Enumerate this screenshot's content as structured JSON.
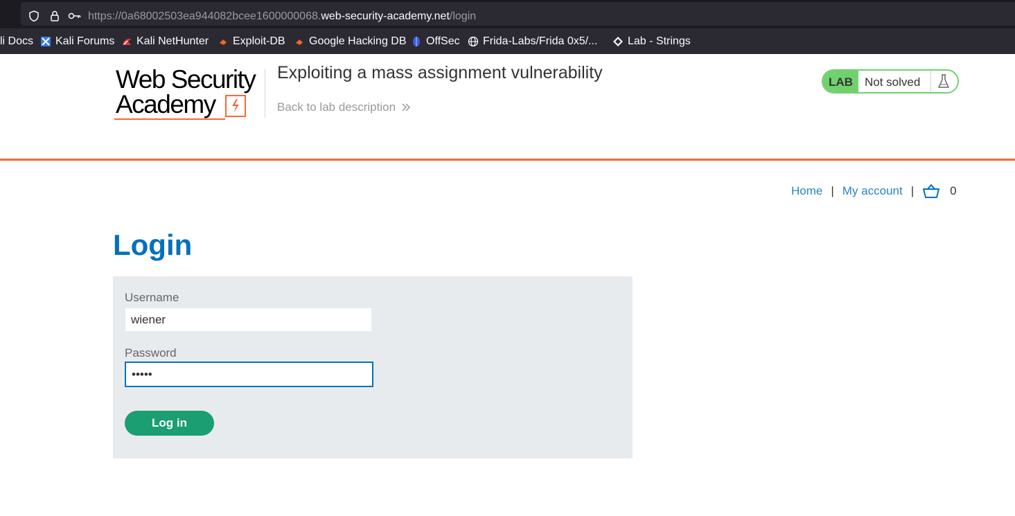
{
  "browser": {
    "url": {
      "prefix": "https://0a68002503ea944082bcee1600000068.",
      "host": "web-security-academy.net",
      "path": "/login"
    },
    "bookmarks": [
      {
        "label": "li Docs",
        "icon": "kali-docs-icon"
      },
      {
        "label": "Kali Forums",
        "icon": "kali-forums-icon"
      },
      {
        "label": "Kali NetHunter",
        "icon": "kali-nethunter-icon"
      },
      {
        "label": "Exploit-DB",
        "icon": "exploit-db-icon"
      },
      {
        "label": "Google Hacking DB",
        "icon": "ghdb-icon"
      },
      {
        "label": "OffSec",
        "icon": "offsec-icon"
      },
      {
        "label": "Frida-Labs/Frida 0x5/...",
        "icon": "globe-icon"
      },
      {
        "label": "Lab - Strings",
        "icon": "lab-strings-icon"
      }
    ]
  },
  "header": {
    "logo_line1": "Web Security",
    "logo_line2": "Academy",
    "lab_title": "Exploiting a mass assignment vulnerability",
    "back_link": "Back to lab description",
    "badge_label": "LAB",
    "badge_status": "Not solved"
  },
  "nav": {
    "home": "Home",
    "separator": "|",
    "my_account": "My account",
    "cart_count": "0"
  },
  "login": {
    "title": "Login",
    "username_label": "Username",
    "username_value": "wiener",
    "password_label": "Password",
    "password_value": "peter",
    "submit_label": "Log in"
  },
  "colors": {
    "accent_orange": "#ff6633",
    "link_blue": "#0071bc",
    "lab_green": "#70d16d",
    "button_green": "#1a9e72",
    "panel_gray": "#e8ebed"
  }
}
